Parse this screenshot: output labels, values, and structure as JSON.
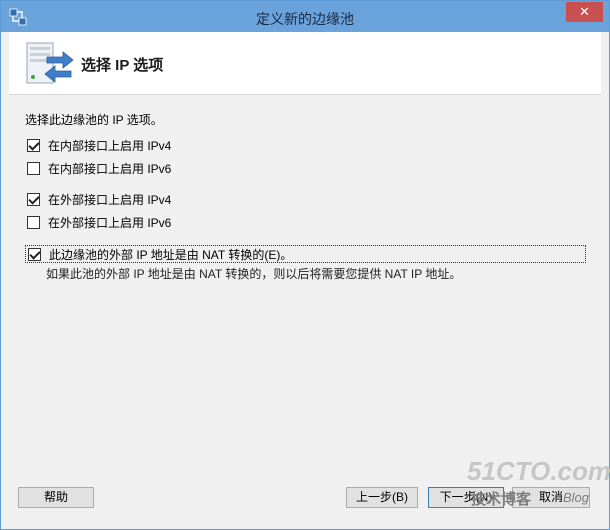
{
  "window": {
    "title": "定义新的边缘池",
    "close_label": "✕"
  },
  "header": {
    "title": "选择 IP 选项"
  },
  "content": {
    "instruction": "选择此边缘池的 IP 选项。",
    "options": [
      {
        "label": "在内部接口上启用 IPv4",
        "checked": true
      },
      {
        "label": "在内部接口上启用 IPv6",
        "checked": false
      },
      {
        "label": "在外部接口上启用 IPv4",
        "checked": true
      },
      {
        "label": "在外部接口上启用 IPv6",
        "checked": false
      }
    ],
    "nat_option": {
      "label": "此边缘池的外部 IP 地址是由 NAT 转换的(E)。",
      "checked": true
    },
    "nat_note": "如果此池的外部 IP 地址是由 NAT 转换的，则以后将需要您提供 NAT IP 地址。"
  },
  "footer": {
    "help_label": "帮助",
    "back_label": "上一步(B)",
    "next_label": "下一步(N)",
    "cancel_label": "取消"
  },
  "watermark": {
    "site": "51CTO.com",
    "tagline": "技术博客",
    "blog": "Blog"
  },
  "colors": {
    "titlebar": "#6aa3db",
    "close": "#c75050",
    "window_bg": "#f0f0f0"
  }
}
